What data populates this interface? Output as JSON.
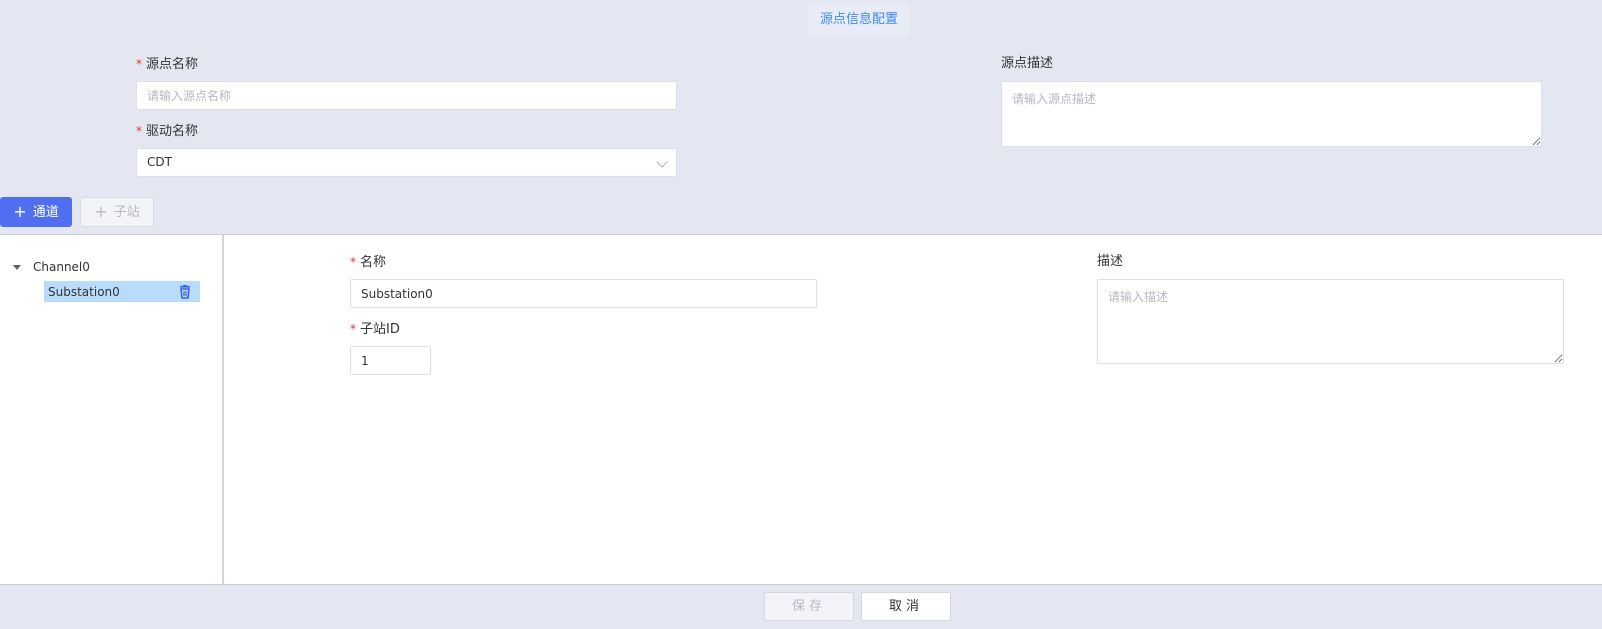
{
  "header": {
    "title": "源点信息配置"
  },
  "source_form": {
    "name_label": "源点名称",
    "name_value": "",
    "name_placeholder": "请输入源点名称",
    "driver_label": "驱动名称",
    "driver_value": "CDT",
    "desc_label": "源点描述",
    "desc_value": "",
    "desc_placeholder": "请输入源点描述"
  },
  "toolbar": {
    "add_channel_label": "通道",
    "add_substation_label": "子站"
  },
  "tree": {
    "channel_label": "Channel0",
    "substation_label": "Substation0"
  },
  "substation_form": {
    "name_label": "名称",
    "name_value": "Substation0",
    "id_label": "子站ID",
    "id_value": "1",
    "desc_label": "描述",
    "desc_value": "",
    "desc_placeholder": "请输入描述"
  },
  "footer": {
    "save_label": "保存",
    "cancel_label": "取消"
  },
  "colors": {
    "primary": "#4f6ff0",
    "title_blue": "#3f8cf0",
    "required": "#e03434",
    "selected_bg": "#b9dcfb",
    "page_bg": "#e4e7f1"
  },
  "icons": [
    "plus-icon",
    "chevron-down-icon",
    "caret-down-icon",
    "trash-icon"
  ]
}
